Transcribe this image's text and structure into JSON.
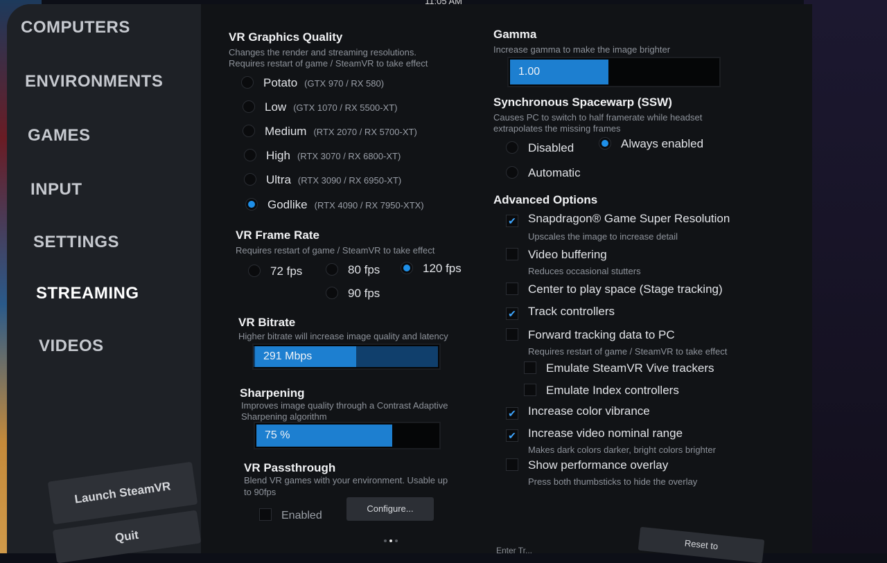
{
  "clock": "11:05 AM",
  "sidebar": {
    "items": [
      {
        "label": "COMPUTERS"
      },
      {
        "label": "ENVIRONMENTS"
      },
      {
        "label": "GAMES"
      },
      {
        "label": "INPUT"
      },
      {
        "label": "SETTINGS"
      },
      {
        "label": "STREAMING",
        "active": true
      },
      {
        "label": "VIDEOS"
      }
    ],
    "launch_label": "Launch SteamVR",
    "quit_label": "Quit"
  },
  "quality": {
    "title": "VR Graphics Quality",
    "desc1": "Changes the render and streaming resolutions.",
    "desc2": "Requires restart of game / SteamVR to take effect",
    "options": [
      {
        "label": "Potato",
        "spec": "(GTX 970 / RX 580)"
      },
      {
        "label": "Low",
        "spec": "(GTX 1070 / RX 5500-XT)"
      },
      {
        "label": "Medium",
        "spec": "(RTX 2070 / RX 5700-XT)"
      },
      {
        "label": "High",
        "spec": "(RTX 3070 / RX 6800-XT)"
      },
      {
        "label": "Ultra",
        "spec": "(RTX 3090 / RX 6950-XT)"
      },
      {
        "label": "Godlike",
        "spec": "(RTX 4090 / RX 7950-XTX)"
      }
    ],
    "selected": "Godlike"
  },
  "framerate": {
    "title": "VR Frame Rate",
    "desc": "Requires restart of game / SteamVR to take effect",
    "options": [
      "72 fps",
      "80 fps",
      "120 fps",
      "90 fps"
    ],
    "selected": "120 fps"
  },
  "bitrate": {
    "title": "VR Bitrate",
    "desc": "Higher bitrate will increase image quality and latency",
    "value": "291 Mbps",
    "fraction": 0.56
  },
  "sharpening": {
    "title": "Sharpening",
    "desc1": "Improves image quality through a Contrast Adaptive",
    "desc2": "Sharpening algorithm",
    "value": "75 %",
    "fraction": 0.75
  },
  "passthrough": {
    "title": "VR Passthrough",
    "desc1": "Blend VR games with your environment. Usable up",
    "desc2": "to 90fps",
    "enabled_label": "Enabled",
    "enabled": false,
    "configure_label": "Configure..."
  },
  "gamma": {
    "title": "Gamma",
    "desc": "Increase gamma to make the image brighter",
    "value": "1.00",
    "fraction": 0.48
  },
  "ssw": {
    "title": "Synchronous Spacewarp (SSW)",
    "desc1": "Causes PC to switch to half framerate while headset",
    "desc2": "extrapolates the missing frames",
    "options": [
      "Disabled",
      "Always enabled",
      "Automatic"
    ],
    "selected": "Always enabled"
  },
  "advanced": {
    "title": "Advanced Options",
    "items": [
      {
        "label": "Snapdragon® Game Super Resolution",
        "desc": "Upscales the image to increase detail",
        "checked": true
      },
      {
        "label": "Video buffering",
        "desc": "Reduces occasional stutters",
        "checked": false
      },
      {
        "label": "Center to play space (Stage tracking)",
        "desc": "",
        "checked": false
      },
      {
        "label": "Track controllers",
        "desc": "",
        "checked": true
      },
      {
        "label": "Forward tracking data to PC",
        "desc": "Requires restart of game / SteamVR to take effect",
        "checked": false
      },
      {
        "label": "Emulate SteamVR Vive trackers",
        "desc": "",
        "checked": false
      },
      {
        "label": "Emulate Index controllers",
        "desc": "",
        "checked": false
      },
      {
        "label": "Increase color vibrance",
        "desc": "",
        "checked": true
      },
      {
        "label": "Increase video nominal range",
        "desc": "Makes dark colors darker, bright colors brighter",
        "checked": true
      },
      {
        "label": "Show performance overlay",
        "desc": "Press both thumbsticks to hide the overlay",
        "checked": false
      }
    ]
  },
  "footer": {
    "reset_label": "Reset to",
    "partial_text": "Enter Tr..."
  }
}
